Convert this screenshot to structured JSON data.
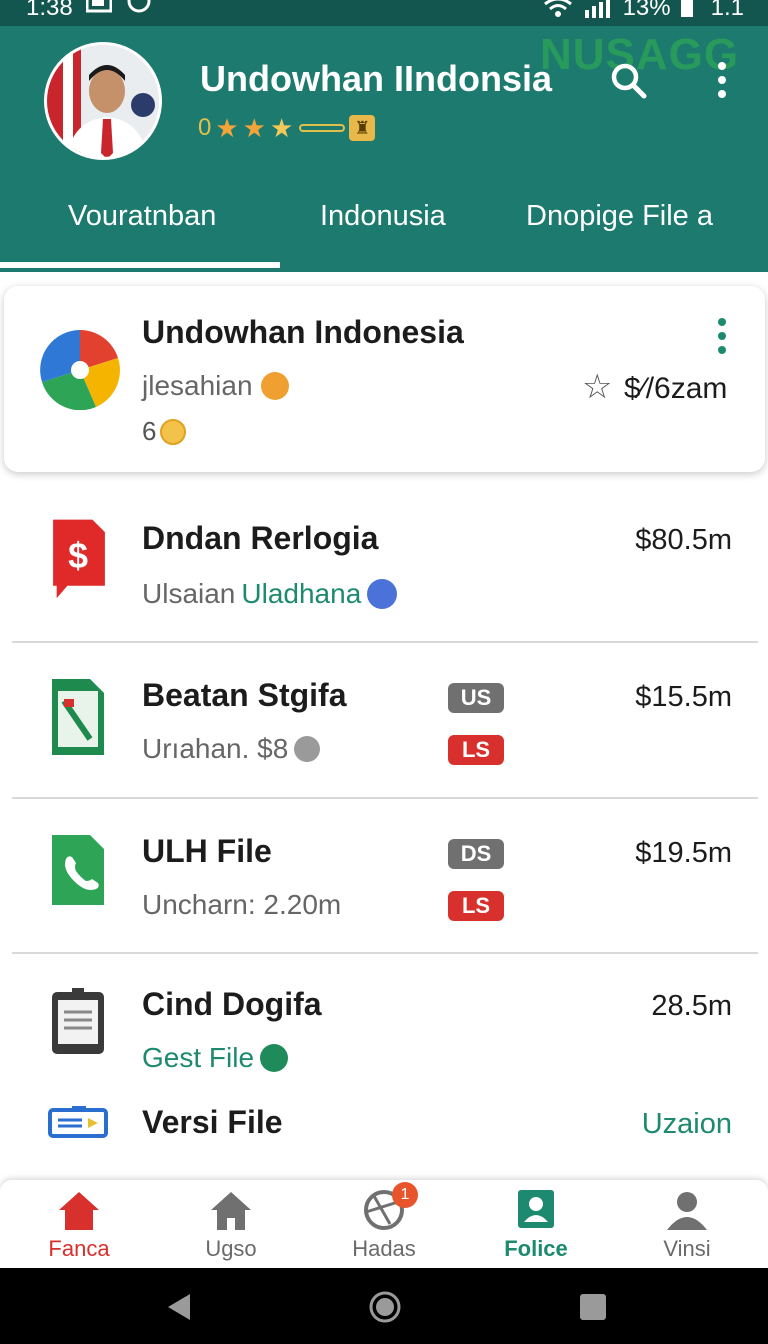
{
  "status_bar": {
    "time": "1:38",
    "battery": "13%",
    "extra": "1.1"
  },
  "header": {
    "app_title": "Undowhan IIndonsia",
    "watermark": "NUSAGG",
    "rating_value": "0",
    "tabs": [
      {
        "label": "Vouratnban"
      },
      {
        "label": "Indonusia"
      },
      {
        "label": "Dnopige File a"
      }
    ],
    "colors": {
      "primary": "#1d7a6f",
      "dark": "#12564f",
      "accent": "#1d8a6f"
    }
  },
  "featured": {
    "title": "Undowhan Indonesia",
    "subtitle": "jlesahian",
    "count": "6",
    "price": "$⁄/6zam"
  },
  "items": [
    {
      "title": "Dndan Rerlogia",
      "subtitle": "Ulsaian",
      "subtitle_accent": "Uladhana",
      "price": "$80.5m",
      "icon": "red-dollar-doc-icon"
    },
    {
      "title": "Beatan Stgifa",
      "subtitle": "Urıahan. $8",
      "price": "$15.5m",
      "tag_top": "US",
      "tag_bottom": "LS",
      "icon": "green-sheet-icon"
    },
    {
      "title": "ULH File",
      "subtitle": "Uncharn: 2.20m",
      "price": "$19.5m",
      "tag_top": "DS",
      "tag_bottom": "LS",
      "icon": "green-phone-doc-icon"
    },
    {
      "title": "Cind Dogifa",
      "subtitle": "Gest File",
      "price": "28.5m",
      "icon": "tablet-icon"
    },
    {
      "title": "Versi File",
      "price": "Uzaion",
      "icon": "ticket-icon"
    }
  ],
  "bottom_nav": [
    {
      "label": "Fanca"
    },
    {
      "label": "Ugso"
    },
    {
      "label": "Hadas",
      "badge": "1"
    },
    {
      "label": "Folice"
    },
    {
      "label": "Vinsi"
    }
  ]
}
